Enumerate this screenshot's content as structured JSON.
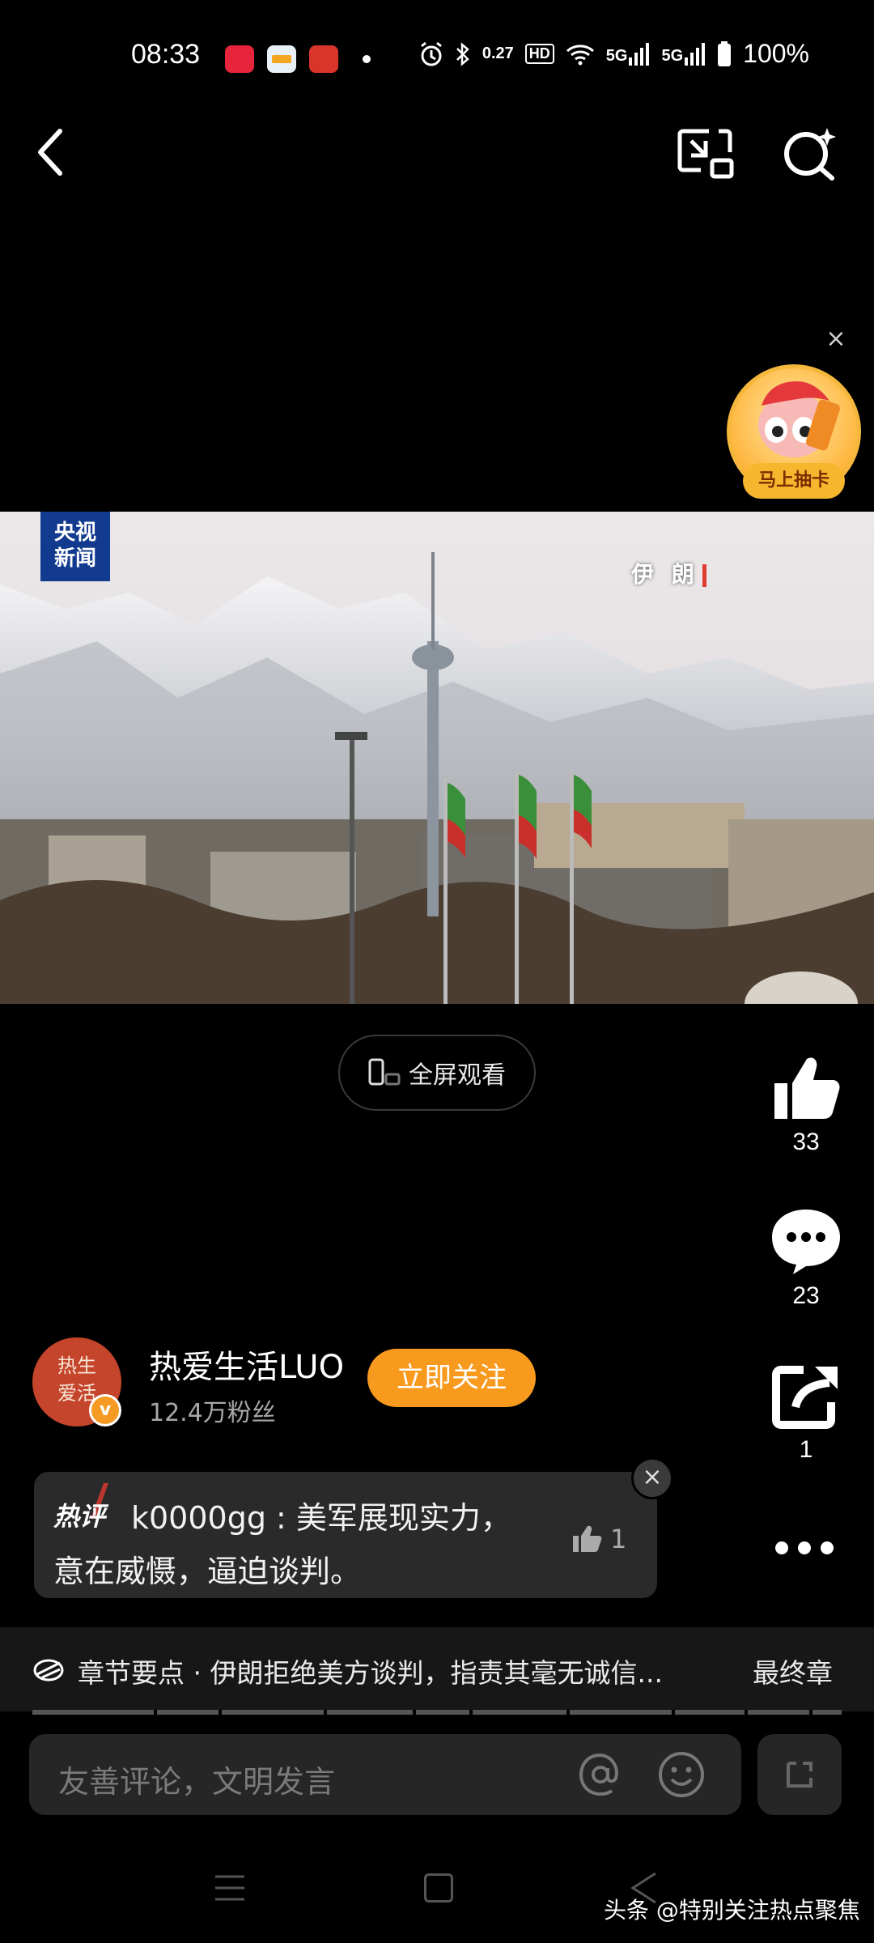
{
  "status_bar": {
    "time": "08:33",
    "data_rate": "0.27",
    "battery": "100%",
    "network_labels": [
      "5G",
      "5G"
    ],
    "hd_label": "HD"
  },
  "video": {
    "channel_logo_line1": "央视",
    "channel_logo_line2": "新闻",
    "location_tag": "伊 朗"
  },
  "promo": {
    "label": "马上抽卡"
  },
  "fullscreen": {
    "label": "全屏观看"
  },
  "actions": {
    "likes": "33",
    "comments": "23",
    "shares": "1"
  },
  "author": {
    "avatar_text": "热生\n爱活",
    "name": "热爱生活LUO",
    "fans": "12.4万粉丝",
    "follow_label": "立即关注"
  },
  "hot_comment": {
    "tag": "热评",
    "text": "k0000gg : 美军展现实力，意在威慑，逼迫谈判。",
    "likes": "1"
  },
  "chapter": {
    "text": "章节要点 · 伊朗拒绝美方谈判，指责其毫无诚信...",
    "end_label": "最终章"
  },
  "comment_input": {
    "placeholder": "友善评论，文明发言"
  },
  "watermark": "头条 @特别关注热点聚焦"
}
